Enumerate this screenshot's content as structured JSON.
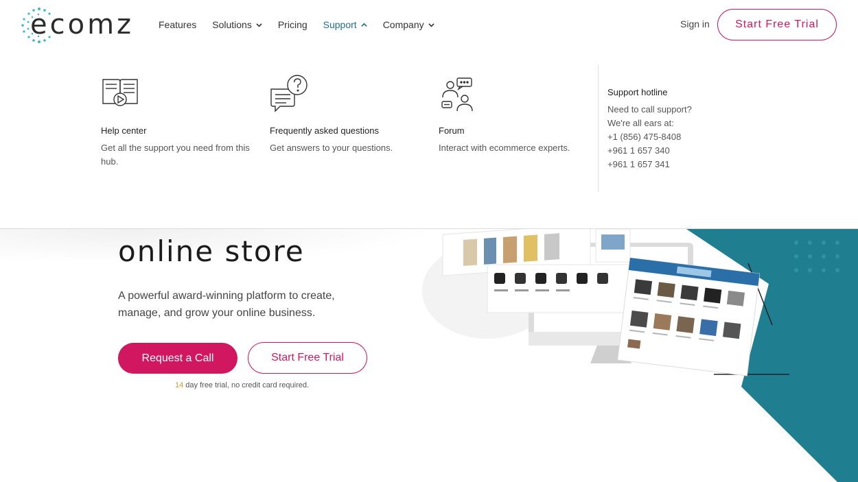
{
  "brand": {
    "logo_text": "ecomz",
    "accent": "#d0175f",
    "teal": "#1f7f90"
  },
  "nav": {
    "items": [
      {
        "label": "Features",
        "dropdown": false,
        "active": false
      },
      {
        "label": "Solutions",
        "dropdown": true,
        "active": false
      },
      {
        "label": "Pricing",
        "dropdown": false,
        "active": false
      },
      {
        "label": "Support",
        "dropdown": true,
        "active": true
      },
      {
        "label": "Company",
        "dropdown": true,
        "active": false
      }
    ],
    "signin": "Sign in",
    "trial": "Start Free Trial"
  },
  "support_menu": {
    "columns": [
      {
        "icon": "video-book-icon",
        "title": "Help center",
        "desc": "Get all the support you need from this hub."
      },
      {
        "icon": "question-chat-icon",
        "title": "Frequently asked questions",
        "desc": "Get answers to your questions."
      },
      {
        "icon": "forum-people-icon",
        "title": "Forum",
        "desc": "Interact with ecommerce experts."
      }
    ],
    "hotline": {
      "title": "Support hotline",
      "lines": [
        "Need to call support?",
        "We're all ears at:",
        "+1 (856) 475-8408",
        "+961 1 657 340",
        "+961 1 657 341"
      ]
    }
  },
  "hero": {
    "title": "online store",
    "subtitle": "A powerful award-winning platform to create, manage, and grow your online business.",
    "cta_call": "Request a Call",
    "cta_trial": "Start Free Trial",
    "note_num": "14",
    "note_text": " day free trial, no credit card required."
  }
}
